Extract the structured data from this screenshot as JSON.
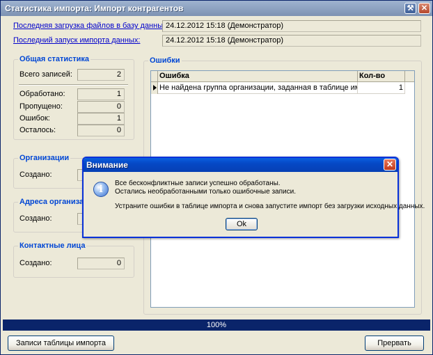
{
  "window": {
    "title": "Статистика импорта: Импорт контрагентов"
  },
  "header": {
    "last_load_label": "Последняя загрузка файлов в базу данных:",
    "last_load_value": "24.12.2012 15:18 (Демонстратор)",
    "last_run_label": "Последний запуск импорта данных:",
    "last_run_value": "24.12.2012 15:18 (Демонстратор)"
  },
  "general": {
    "title": "Общая статистика",
    "total_label": "Всего записей:",
    "total_value": "2",
    "processed_label": "Обработано:",
    "processed_value": "1",
    "skipped_label": "Пропущено:",
    "skipped_value": "0",
    "errors_label": "Ошибок:",
    "errors_value": "1",
    "remaining_label": "Осталось:",
    "remaining_value": "0"
  },
  "organizations": {
    "title": "Организации",
    "created_label": "Создано:"
  },
  "addresses": {
    "title": "Адреса организации",
    "created_label": "Создано:"
  },
  "contacts": {
    "title": "Контактные лица",
    "created_label": "Создано:",
    "created_value": "0"
  },
  "errors_panel": {
    "title": "Ошибки",
    "columns": [
      "Ошибка",
      "Кол-во"
    ],
    "rows": [
      [
        "Не найдена группа организации, заданная в таблице импорта",
        "1"
      ]
    ]
  },
  "progress": {
    "text": "100%",
    "value": 100
  },
  "buttons": {
    "records": "Записи таблицы импорта",
    "abort": "Прервать"
  },
  "dialog": {
    "title": "Внимание",
    "line1": "Все бесконфликтные записи успешно обработаны.",
    "line2": "Остались необработанными только ошибочные записи.",
    "line3": "Устраните ошибки в таблице импорта и снова запустите импорт без загрузки исходных данных.",
    "ok": "Ok",
    "icon": "info-icon"
  }
}
